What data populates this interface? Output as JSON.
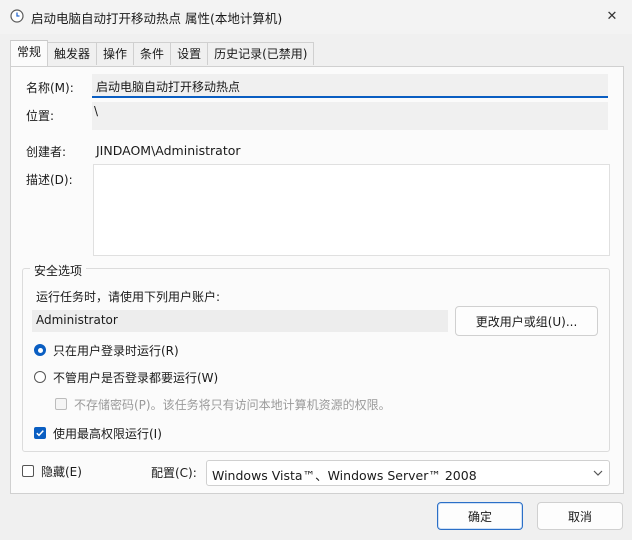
{
  "window": {
    "title": "启动电脑自动打开移动热点 属性(本地计算机)",
    "close_glyph": "✕"
  },
  "tabs": [
    {
      "label": "常规",
      "active": true
    },
    {
      "label": "触发器"
    },
    {
      "label": "操作"
    },
    {
      "label": "条件"
    },
    {
      "label": "设置"
    },
    {
      "label": "历史记录(已禁用)"
    }
  ],
  "general": {
    "name_label": "名称(M):",
    "name_value": "启动电脑自动打开移动热点",
    "location_label": "位置:",
    "location_value": "\\",
    "author_label": "创建者:",
    "author_value": "JINDAOM\\Administrator",
    "description_label": "描述(D):",
    "description_value": ""
  },
  "security": {
    "group_title": "安全选项",
    "run_as_label": "运行任务时，请使用下列用户账户:",
    "user_account": "Administrator",
    "change_user_button": "更改用户或组(U)...",
    "radio_logged_on": "只在用户登录时运行(R)",
    "radio_whether": "不管用户是否登录都要运行(W)",
    "no_store_password": "不存储密码(P)。该任务将只有访问本地计算机资源的权限。",
    "highest_privileges": "使用最高权限运行(I)"
  },
  "bottom": {
    "hidden_label": "隐藏(E)",
    "configure_label": "配置(C):",
    "configure_value": "Windows Vista™、Windows Server™ 2008"
  },
  "buttons": {
    "ok": "确定",
    "cancel": "取消"
  },
  "colors": {
    "accent": "#0a5ec2",
    "window_bg": "#f0f0f0",
    "panel_bg": "#fbfbfb"
  }
}
